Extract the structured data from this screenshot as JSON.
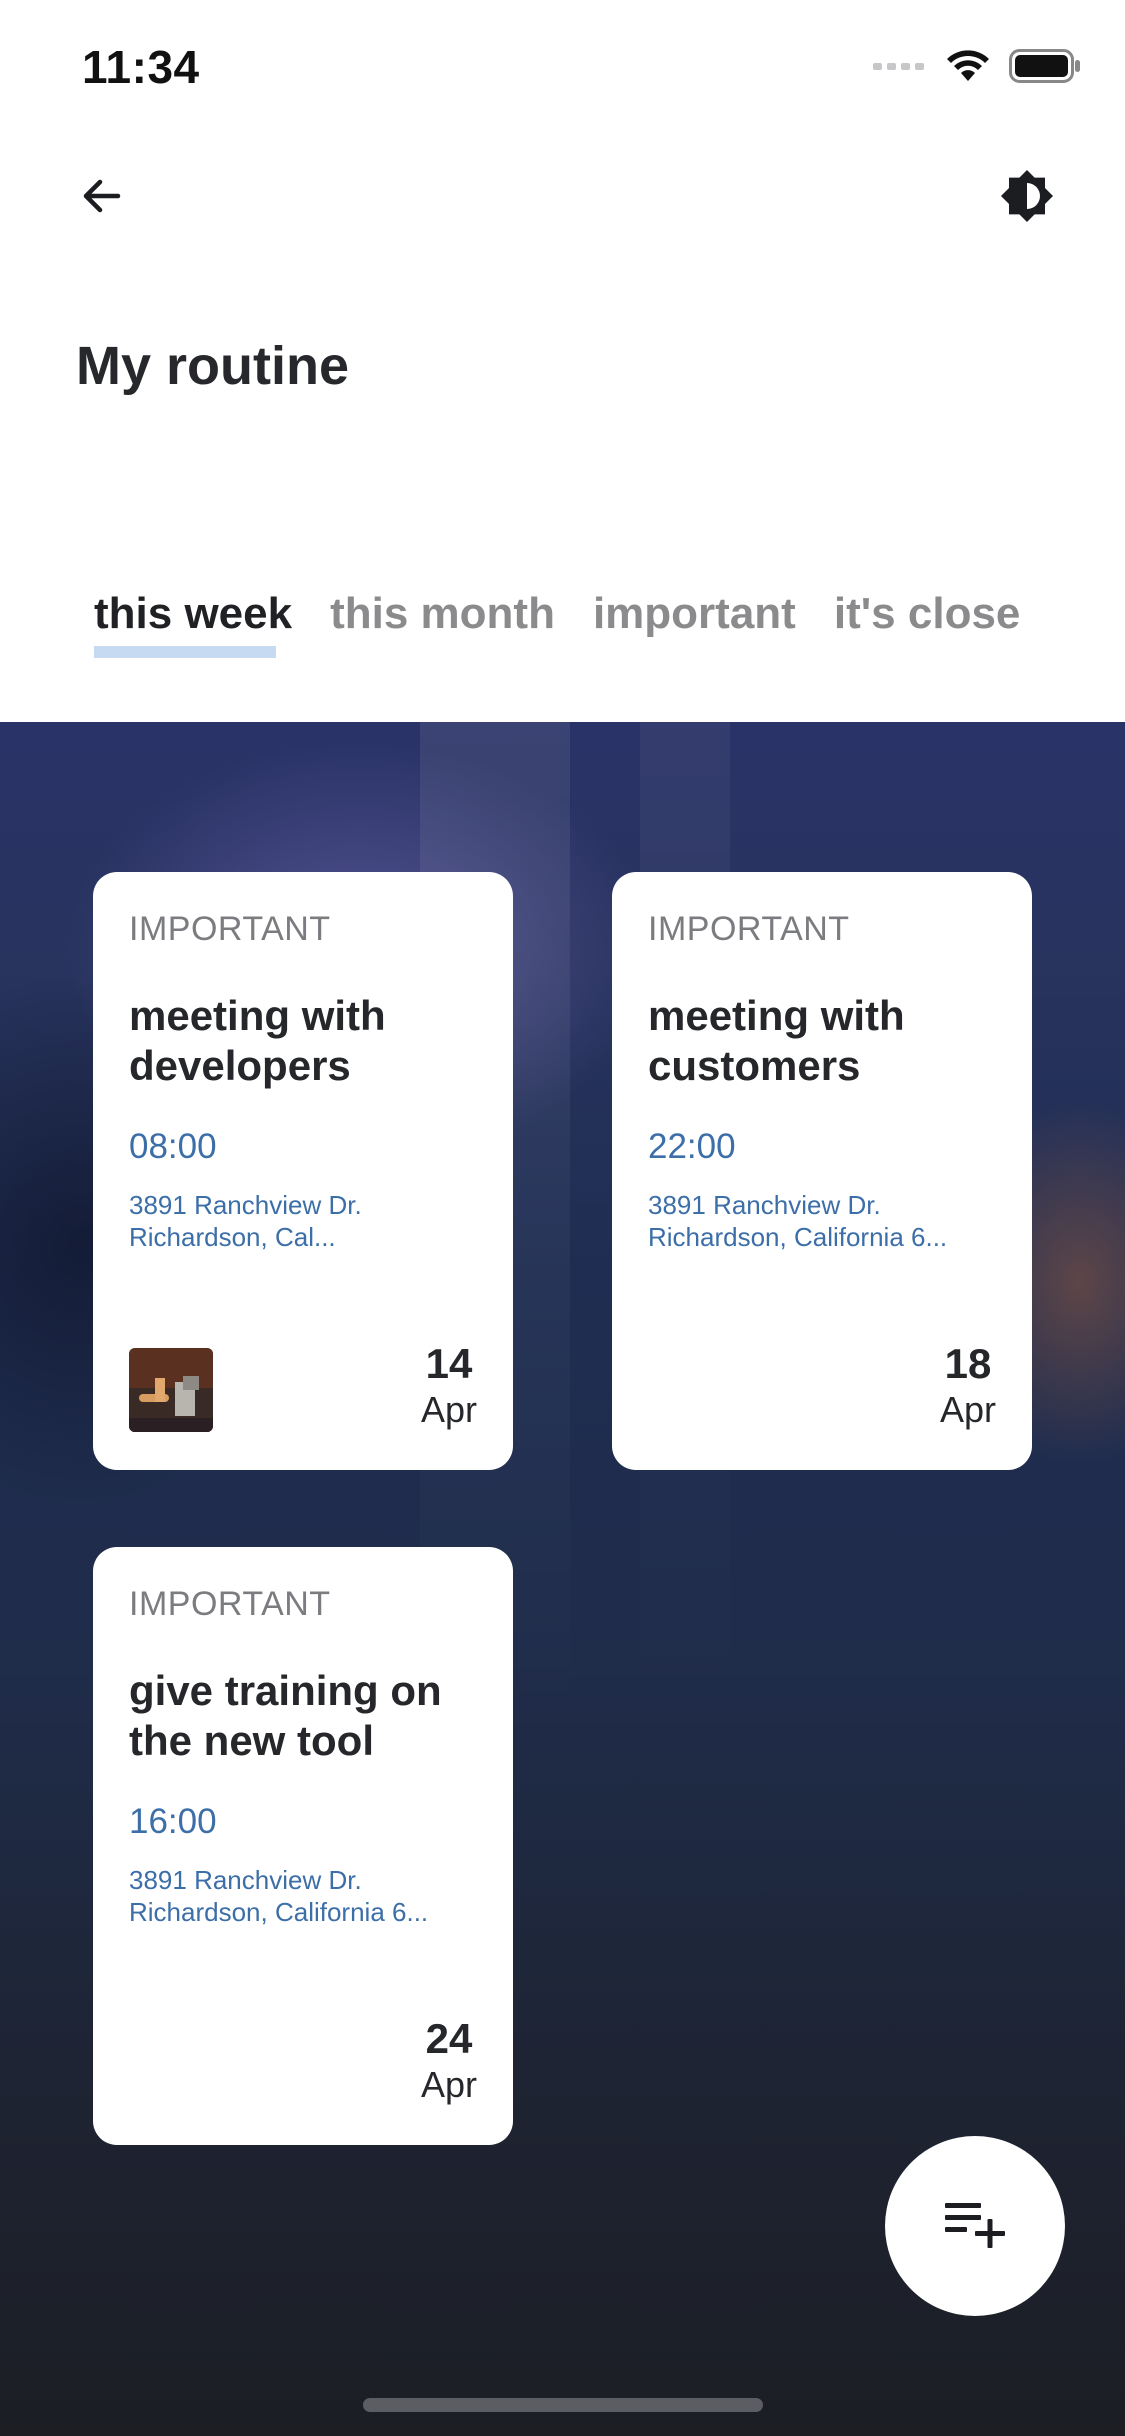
{
  "status_bar": {
    "time": "11:34",
    "icons": [
      "signal-icon",
      "wifi-icon",
      "battery-icon"
    ]
  },
  "header": {
    "back_icon": "arrow-left-icon",
    "theme_icon": "brightness-contrast-icon",
    "title": "My routine"
  },
  "tabs": [
    {
      "label": "this week",
      "active": true
    },
    {
      "label": "this month",
      "active": false
    },
    {
      "label": "important",
      "active": false
    },
    {
      "label": "it's close",
      "active": false
    }
  ],
  "cards": [
    {
      "tag": "IMPORTANT",
      "title": "meeting with developers",
      "time": "08:00",
      "address_line1": "3891 Ranchview Dr.",
      "address_line2": "Richardson, Cal...",
      "day": "14",
      "month": "Apr",
      "has_thumbnail": true
    },
    {
      "tag": "IMPORTANT",
      "title": "meeting with customers",
      "time": "22:00",
      "address_line1": "3891 Ranchview Dr.",
      "address_line2": "Richardson, California 6...",
      "day": "18",
      "month": "Apr",
      "has_thumbnail": false
    },
    {
      "tag": "IMPORTANT",
      "title": "give training on the new tool",
      "time": "16:00",
      "address_line1": "3891 Ranchview Dr.",
      "address_line2": "Richardson, California 6...",
      "day": "24",
      "month": "Apr",
      "has_thumbnail": false
    }
  ],
  "fab": {
    "icon": "playlist-add-icon"
  },
  "colors": {
    "accent_blue": "#3c6ea8",
    "tab_indicator": "#c6daf2",
    "backdrop_top": "#2a3368",
    "backdrop_bottom": "#1c1e24"
  }
}
